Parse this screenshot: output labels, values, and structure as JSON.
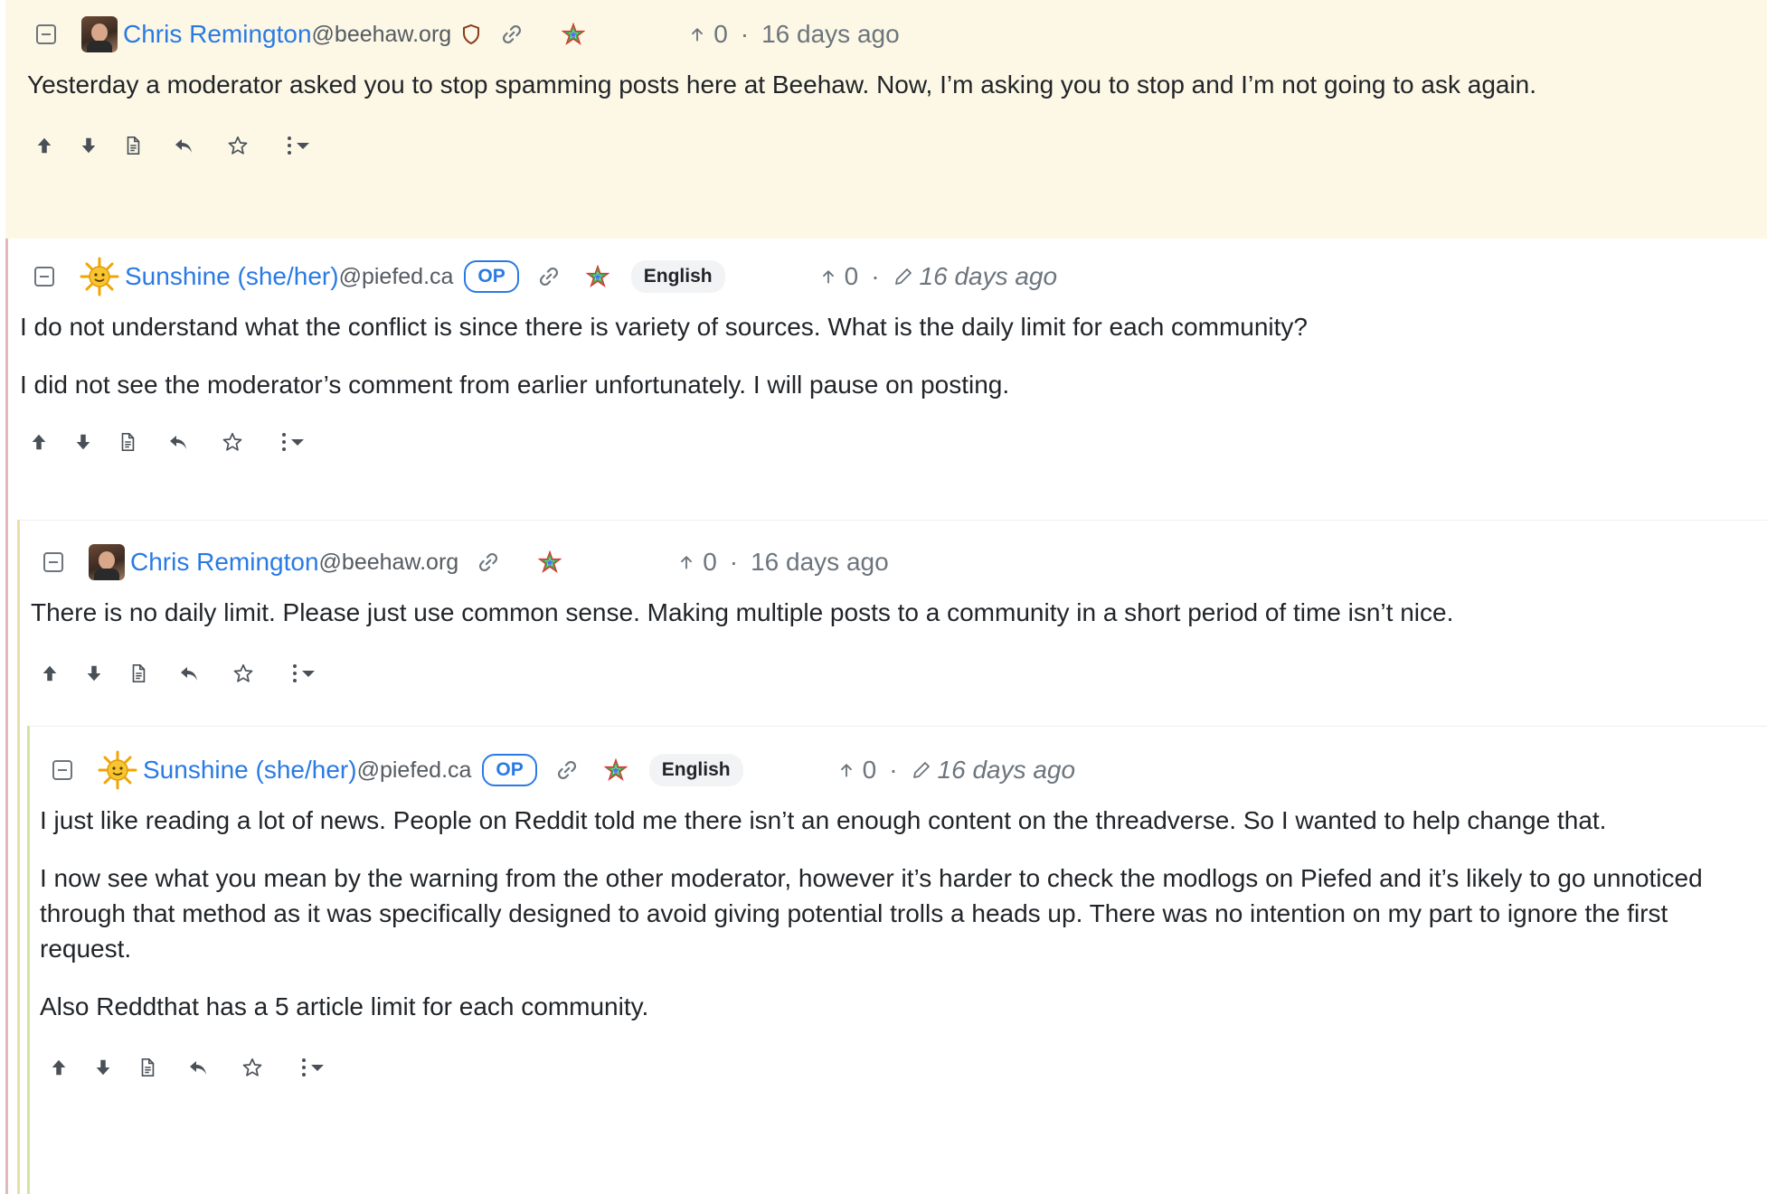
{
  "icons": {
    "collapse": "collapse-icon",
    "shield": "shield-icon",
    "link": "link-icon",
    "rainbow": "rainbow-star-icon",
    "upvote": "arrow-up-icon",
    "downvote": "arrow-down-icon",
    "source": "document-icon",
    "reply": "reply-icon",
    "save": "star-icon",
    "more": "more-icon",
    "edited": "pencil-icon"
  },
  "colors": {
    "author": "#2a7ae4",
    "highlight_bg": "#fdf8e6",
    "thread_line_1": "#e3b8b8",
    "thread_line_2": "#e8dfa4",
    "thread_line_3": "#d4e3a4"
  },
  "comments": [
    {
      "author": "Chris Remington",
      "domain": "@beehaw.org",
      "score": "0",
      "age": "16 days ago",
      "paragraphs": [
        "Yesterday a moderator asked you to stop spamming posts here at Beehaw. Now, I’m asking you to stop and I’m not going to ask again."
      ]
    },
    {
      "author": "Sunshine (she/her)",
      "domain": "@piefed.ca",
      "badge": "OP",
      "language": "English",
      "score": "0",
      "age": "16 days ago",
      "paragraphs": [
        "I do not understand what the conflict is since there is variety of sources. What is the daily limit for each community?",
        "I did not see the moderator’s comment from earlier unfortunately. I will pause on posting."
      ]
    },
    {
      "author": "Chris Remington",
      "domain": "@beehaw.org",
      "score": "0",
      "age": "16 days ago",
      "paragraphs": [
        "There is no daily limit. Please just use common sense. Making multiple posts to a community in a short period of time isn’t nice."
      ]
    },
    {
      "author": "Sunshine (she/her)",
      "domain": "@piefed.ca",
      "badge": "OP",
      "language": "English",
      "score": "0",
      "age": "16 days ago",
      "paragraphs": [
        "I just like reading a lot of news. People on Reddit told me there isn’t an enough content on the threadverse. So I wanted to help change that.",
        "I now see what you mean by the warning from the other moderator, however it’s harder to check the modlogs on Piefed and it’s likely to go unnoticed through that method as it was specifically designed to avoid giving potential trolls a heads up. There was no intention on my part to ignore the first request.",
        "Also Reddthat has a 5 article limit for each community."
      ]
    }
  ]
}
